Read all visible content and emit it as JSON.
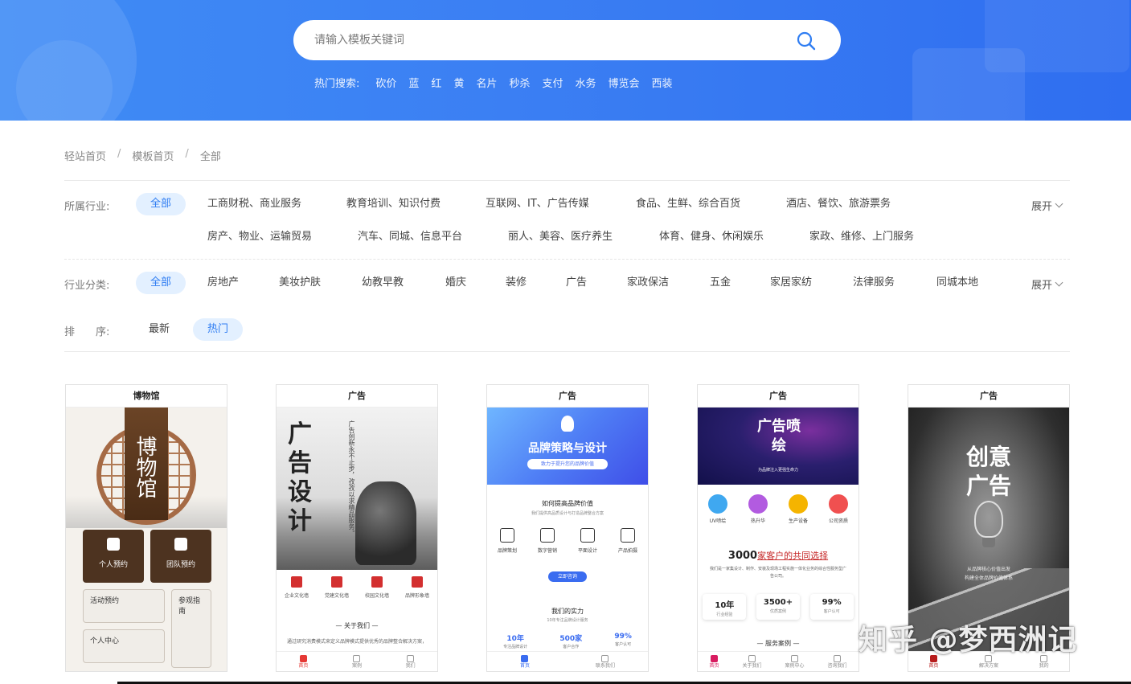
{
  "search": {
    "placeholder": "请输入模板关键词",
    "hot_label": "热门搜索:",
    "hot_items": [
      "砍价",
      "蓝",
      "红",
      "黄",
      "名片",
      "秒杀",
      "支付",
      "水务",
      "博览会",
      "西装"
    ]
  },
  "breadcrumb": [
    "轻站首页",
    "模板首页",
    "全部"
  ],
  "filters": {
    "industry": {
      "label": "所属行业:",
      "all": "全部",
      "row1": [
        "工商财税、商业服务",
        "教育培训、知识付费",
        "互联网、IT、广告传媒",
        "食品、生鲜、综合百货",
        "酒店、餐饮、旅游票务"
      ],
      "row2": [
        "房产、物业、运输贸易",
        "汽车、同城、信息平台",
        "丽人、美容、医疗养生",
        "体育、健身、休闲娱乐",
        "家政、维修、上门服务"
      ],
      "expand": "展开"
    },
    "category": {
      "label": "行业分类:",
      "all": "全部",
      "items": [
        "房地产",
        "美妆护肤",
        "幼教早教",
        "婚庆",
        "装修",
        "广告",
        "家政保洁",
        "五金",
        "家居家纺",
        "法律服务",
        "同城本地"
      ],
      "expand": "展开"
    },
    "sort": {
      "label": "排　　序:",
      "options": [
        "最新",
        "热门"
      ],
      "active": "热门"
    }
  },
  "cards": [
    {
      "title": "博物馆",
      "hero_text": "博物馆",
      "btn1": "个人预约",
      "btn2": "团队预约",
      "btn3": "活动预约",
      "btn4": "参观指南",
      "btn5": "个人中心"
    },
    {
      "title": "广告",
      "hero_text": "广告设计",
      "vertical_text": "广告创新永不止步，孜孜以求精品服务。",
      "icons": [
        "企业文化墙",
        "党建文化墙",
        "校园文化墙",
        "品牌形象墙"
      ],
      "about": "— 关于我们 —",
      "about_desc": "通过研究消费模式来定义品牌模式提供优秀的品牌整合解决方案，",
      "tabs": [
        "首页",
        "案例",
        "我们"
      ]
    },
    {
      "title": "广告",
      "hero_title": "品牌策略与设计",
      "hero_sub": "致力于提升您的品牌价值",
      "sec1": "如何提高品牌价值",
      "sec1_sub": "我们提供高品质设计与打造品牌整合方案",
      "icons": [
        "品牌策划",
        "数字营销",
        "平面设计",
        "产品拍摄"
      ],
      "cta": "立即咨询",
      "sec2": "我们的实力",
      "sec2_sub": "10年专注品牌设计服务",
      "stats": [
        {
          "value": "10年",
          "label": "专注品牌设计"
        },
        {
          "value": "500家",
          "label": "客户合作"
        },
        {
          "value": "99%",
          "label": "客户认可"
        }
      ],
      "tabs": [
        "首页",
        "联系我们"
      ]
    },
    {
      "title": "广告",
      "hero_title": "广告喷绘",
      "hero_sub": "为品牌注入更强生命力",
      "icons": [
        "UV喷绘",
        "热升华",
        "生产设备",
        "公司资质"
      ],
      "headline_num": "3000",
      "headline_text": "家客户的共同选择",
      "desc": "我们是一家集设计、制作、安装及现场工程实施一体化业务的综合性服务型广告公司。",
      "stats": [
        {
          "value": "10年",
          "label": "行业经验"
        },
        {
          "value": "3500+",
          "label": "优质案例"
        },
        {
          "value": "99%",
          "label": "客户认可"
        }
      ],
      "case": "— 服务案例 —",
      "tabs": [
        "首页",
        "关于我们",
        "案例中心",
        "咨询我们"
      ]
    },
    {
      "title": "广告",
      "hero_title": "创意广告",
      "sub1": "从品牌核心价值出发",
      "sub2": "构建全体品牌价值体系",
      "tabs": [
        "首页",
        "解决方案",
        "我的"
      ]
    }
  ],
  "watermark": "知乎 @梦西洲记",
  "colors": {
    "banner": "#3b7ff3",
    "accent": "#2f7df2",
    "chip_bg": "#e3f0ff"
  }
}
